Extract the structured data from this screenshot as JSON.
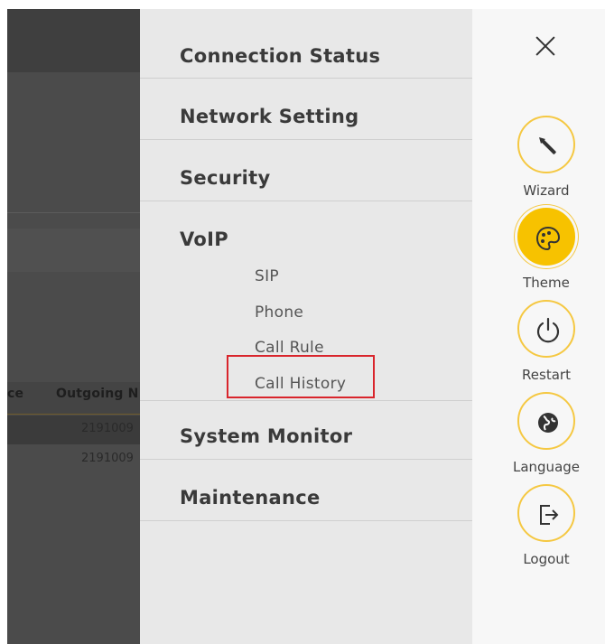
{
  "background_page": {
    "table": {
      "headers": [
        "ce",
        "Outgoing N"
      ],
      "rows": [
        "2191009",
        "2191009"
      ]
    }
  },
  "menu": {
    "items": [
      {
        "label": "Connection Status"
      },
      {
        "label": "Network Setting"
      },
      {
        "label": "Security"
      },
      {
        "label": "VoIP"
      },
      {
        "label": "System Monitor"
      },
      {
        "label": "Maintenance"
      }
    ],
    "voip_subitems": [
      "SIP",
      "Phone",
      "Call Rule",
      "Call History"
    ],
    "highlighted_subitem": "Call History",
    "highlight_color": "#d9252c"
  },
  "toolbar": {
    "close_icon": "close-icon",
    "accent_color": "#f7c200",
    "tools": [
      {
        "label": "Wizard",
        "icon": "wand-icon",
        "active": false
      },
      {
        "label": "Theme",
        "icon": "palette-icon",
        "active": true
      },
      {
        "label": "Restart",
        "icon": "power-icon",
        "active": false
      },
      {
        "label": "Language",
        "icon": "globe-icon",
        "active": false
      },
      {
        "label": "Logout",
        "icon": "logout-icon",
        "active": false
      }
    ]
  }
}
